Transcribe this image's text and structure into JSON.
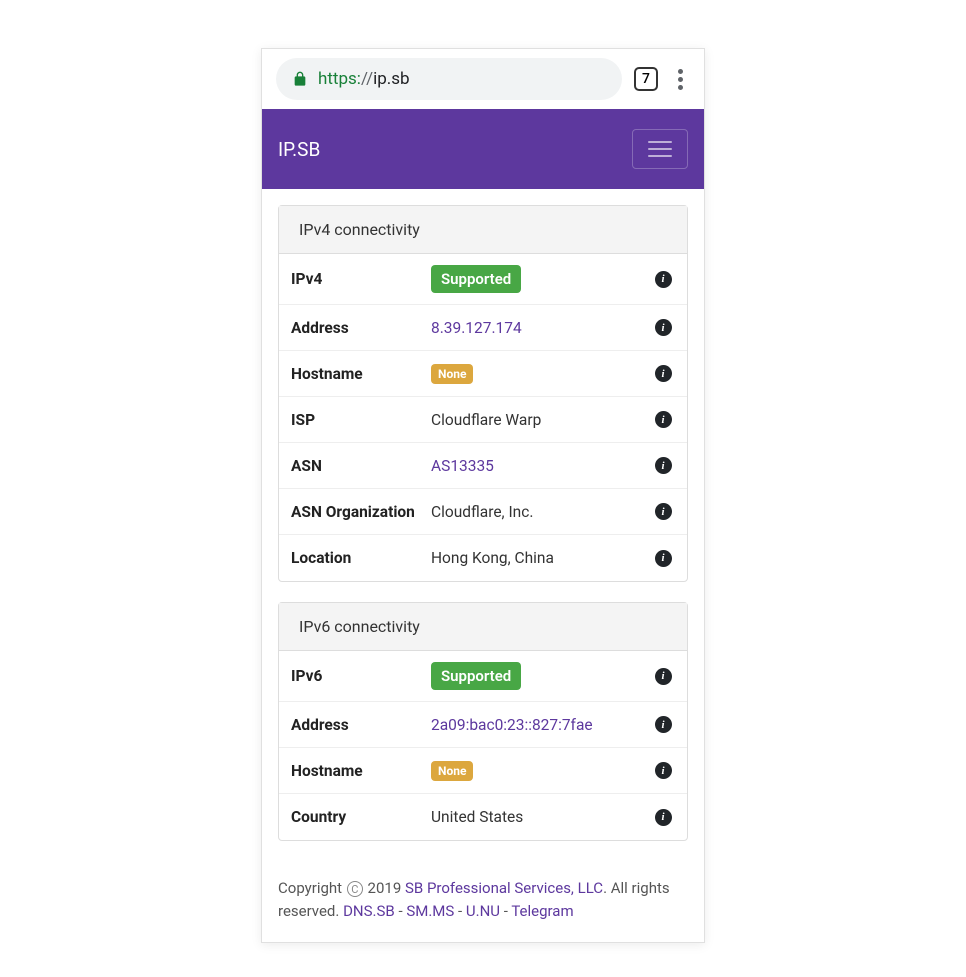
{
  "browser": {
    "scheme": "https:",
    "sep": "//",
    "host": "ip.sb",
    "tab_count": "7"
  },
  "navbar": {
    "brand": "IP.SB"
  },
  "ipv4": {
    "header": "IPv4 connectivity",
    "rows": {
      "ipv4": {
        "label": "IPv4",
        "value": "Supported"
      },
      "address": {
        "label": "Address",
        "value": "8.39.127.174"
      },
      "hostname": {
        "label": "Hostname",
        "value": "None"
      },
      "isp": {
        "label": "ISP",
        "value": "Cloudflare Warp"
      },
      "asn": {
        "label": "ASN",
        "value": "AS13335"
      },
      "asn_org": {
        "label": "ASN Organization",
        "value": "Cloudflare, Inc."
      },
      "location": {
        "label": "Location",
        "value": "Hong Kong, China"
      }
    }
  },
  "ipv6": {
    "header": "IPv6 connectivity",
    "rows": {
      "ipv6": {
        "label": "IPv6",
        "value": "Supported"
      },
      "address": {
        "label": "Address",
        "value": "2a09:bac0:23::827:7fae"
      },
      "hostname": {
        "label": "Hostname",
        "value": "None"
      },
      "country": {
        "label": "Country",
        "value": "United States"
      }
    }
  },
  "footer": {
    "copyright_prefix": "Copyright ",
    "copyright_c": "C",
    "year": " 2019 ",
    "company": "SB Professional Services, LLC",
    "rights": ". All rights reserved. ",
    "link1": "DNS.SB",
    "sep": " - ",
    "link2": "SM.MS",
    "link3": "U.NU",
    "link4": "Telegram"
  }
}
